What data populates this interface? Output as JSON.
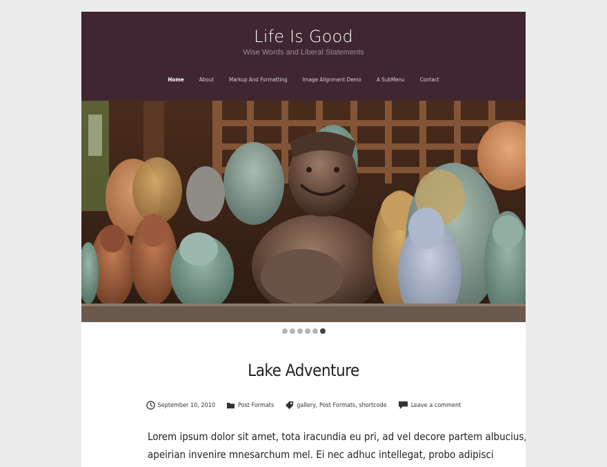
{
  "site": {
    "title": "Life Is Good",
    "tagline": "Wise Words and Liberal Statements"
  },
  "nav": {
    "items": [
      {
        "label": "Home",
        "active": true
      },
      {
        "label": "About"
      },
      {
        "label": "Markup And Formatting"
      },
      {
        "label": "Image Alignment Demo"
      },
      {
        "label": "A SubMenu"
      },
      {
        "label": "Contact"
      }
    ]
  },
  "slider": {
    "image_icon": "photo-slide",
    "slide_count": 6,
    "active_index": 5
  },
  "post": {
    "title": "Lake Adventure",
    "date": "September 10, 2010",
    "category": "Post Formats",
    "tags": "gallery, Post Formats, shortcode",
    "comment_link": "Leave a comment",
    "excerpt_line_1": "Lorem ipsum dolor sit amet, tota iracundia eu pri, ad vel decore partem albucius, ut",
    "excerpt_line_2": "apeirian invenire mnesarchum mel. Ei nec adhuc intellegat, probo adipisci"
  },
  "icons": {
    "date": "clock-icon",
    "category": "folder-icon",
    "tags": "tag-icon",
    "comments": "comment-icon"
  },
  "colors": {
    "header_bg": "#402631",
    "page_bg": "#ececec",
    "dot_active": "#444444",
    "dot_inactive": "#b5b5b5"
  }
}
